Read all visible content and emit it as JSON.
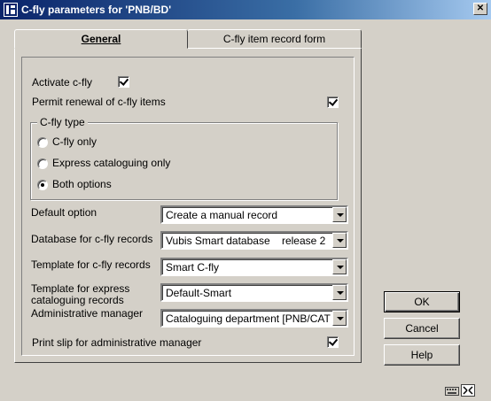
{
  "window": {
    "title": "C-fly parameters for 'PNB/BD'",
    "close_label": "✕"
  },
  "tabs": [
    {
      "label": "General",
      "active": true
    },
    {
      "label": "C-fly item record form",
      "active": false
    }
  ],
  "general": {
    "activate_label": "Activate c-fly",
    "activate_checked": true,
    "renewal_label": "Permit renewal of c-fly items",
    "renewal_checked": true,
    "cfly_type": {
      "title": "C-fly type",
      "options": [
        {
          "label": "C-fly only",
          "selected": false
        },
        {
          "label": "Express cataloguing only",
          "selected": false
        },
        {
          "label": "Both options",
          "selected": true
        }
      ]
    },
    "fields": [
      {
        "label": "Default option",
        "value": "Create a manual record"
      },
      {
        "label": "Database for c-fly records",
        "value": "Vubis Smart database    release 2"
      },
      {
        "label": "Template for c-fly records",
        "value": "Smart C-fly"
      },
      {
        "label": "Template for express\ncataloguing records",
        "value": "Default-Smart"
      },
      {
        "label": "Administrative manager",
        "value": "Cataloguing department [PNB/CAT]"
      }
    ],
    "print_slip_label": "Print slip for administrative manager",
    "print_slip_checked": true
  },
  "buttons": {
    "ok": "OK",
    "cancel": "Cancel",
    "help": "Help"
  },
  "status_icons": [
    "keyboard-icon",
    "resize-grip-icon"
  ]
}
